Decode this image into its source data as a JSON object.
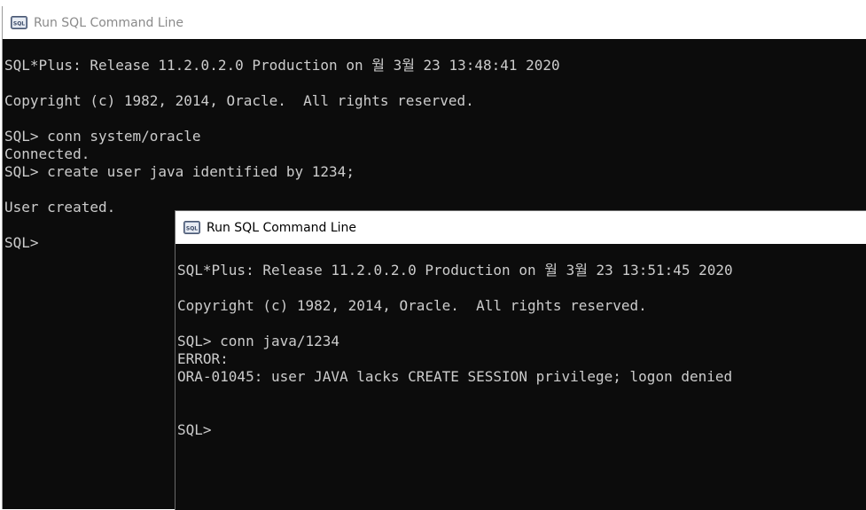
{
  "back_window": {
    "title": "Run SQL Command Line",
    "lines": [
      "",
      "SQL*Plus: Release 11.2.0.2.0 Production on 월 3월 23 13:48:41 2020",
      "",
      "Copyright (c) 1982, 2014, Oracle.  All rights reserved.",
      "",
      "SQL> conn system/oracle",
      "Connected.",
      "SQL> create user java identified by 1234;",
      "",
      "User created.",
      "",
      "SQL>"
    ]
  },
  "front_window": {
    "title": "Run SQL Command Line",
    "lines": [
      "",
      "SQL*Plus: Release 11.2.0.2.0 Production on 월 3월 23 13:51:45 2020",
      "",
      "Copyright (c) 1982, 2014, Oracle.  All rights reserved.",
      "",
      "SQL> conn java/1234",
      "ERROR:",
      "ORA-01045: user JAVA lacks CREATE SESSION privilege; logon denied",
      "",
      "",
      "SQL>"
    ]
  },
  "icon": "sql-app-icon",
  "colors": {
    "console_bg": "#0c0c0c",
    "console_text": "#cccccc",
    "titlebar_bg": "#ffffff",
    "inactive_title": "#8a8a8a",
    "active_title": "#000000"
  }
}
